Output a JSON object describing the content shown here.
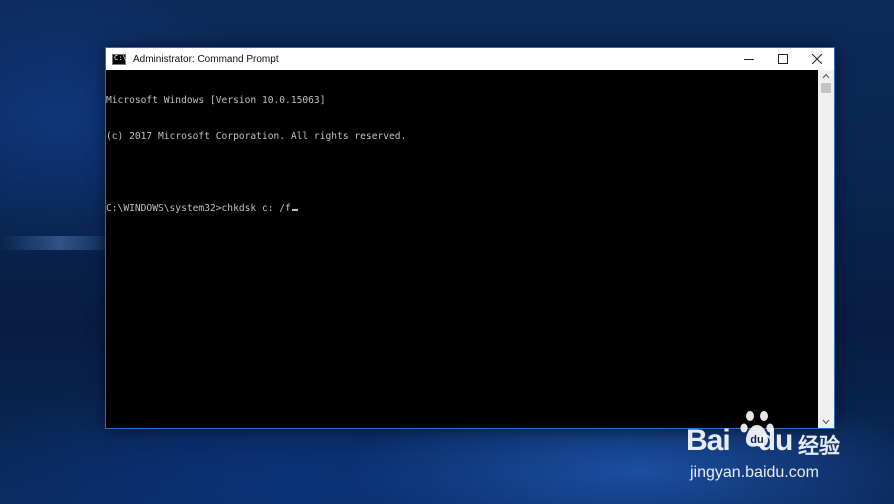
{
  "window": {
    "title": "Administrator: Command Prompt",
    "controls": {
      "minimize": "minimize-icon",
      "maximize": "maximize-icon",
      "close": "close-icon"
    }
  },
  "console": {
    "lines": [
      "Microsoft Windows [Version 10.0.15063]",
      "(c) 2017 Microsoft Corporation. All rights reserved.",
      "",
      "C:\\WINDOWS\\system32>chkdsk c: /f"
    ],
    "text_color": "#c0c0c0",
    "background": "#000000"
  },
  "watermark": {
    "brand": "Bai",
    "brand_suffix": "du",
    "product": "经验",
    "url": "jingyan.baidu.com"
  },
  "colors": {
    "window_border": "#2b6cc4",
    "titlebar": "#ffffff",
    "desktop": "#0a2550"
  }
}
